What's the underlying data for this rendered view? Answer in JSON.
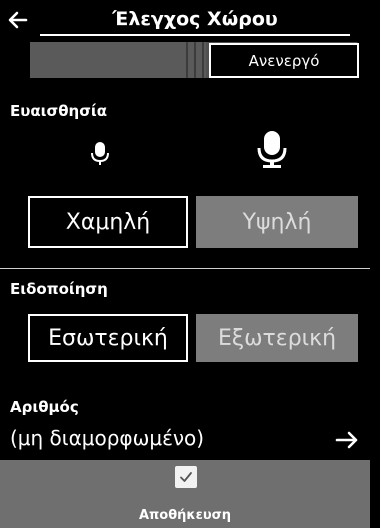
{
  "header": {
    "title": "Έλεγχος Χώρου",
    "back_icon": "back-arrow-icon"
  },
  "toggle": {
    "value": "Ανενεργό"
  },
  "sensitivity": {
    "label": "Ευαισθησία",
    "options": [
      "Χαμηλή",
      "Υψηλή"
    ],
    "selected": "Χαμηλή"
  },
  "notification": {
    "label": "Ειδοποίηση",
    "options": [
      "Εσωτερική",
      "Εξωτερική"
    ],
    "selected": "Εσωτερική"
  },
  "number": {
    "label": "Αριθμός",
    "value": "(μη διαμορφωμένο)",
    "next_icon": "arrow-right-icon"
  },
  "footer": {
    "save_label": "Αποθήκευση",
    "icon": "checkmark-icon"
  },
  "colors": {
    "background": "#000000",
    "selected_button": "#000000",
    "dim_button": "#7d7d7d",
    "footer": "#6f6f6f"
  }
}
